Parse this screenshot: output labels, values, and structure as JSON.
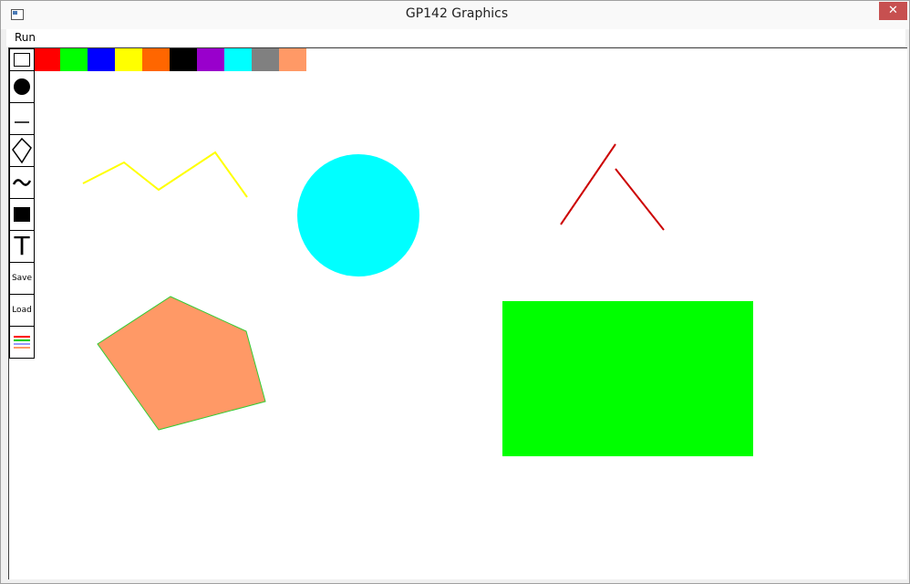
{
  "window": {
    "title": "GP142 Graphics",
    "close_label": "✕"
  },
  "menu": {
    "items": [
      "Run"
    ]
  },
  "toolbox": {
    "tools": [
      {
        "name": "rectangle-outline-tool",
        "icon": "rect-outline-icon"
      },
      {
        "name": "filled-circle-tool",
        "icon": "filled-circle-icon"
      },
      {
        "name": "line-tool",
        "icon": "line-icon"
      },
      {
        "name": "polygon-tool",
        "icon": "diamond-outline-icon"
      },
      {
        "name": "freehand-tool",
        "icon": "tilde-icon"
      },
      {
        "name": "filled-rectangle-tool",
        "icon": "filled-square-icon"
      },
      {
        "name": "text-tool",
        "icon": "text-t-icon",
        "label": "T"
      },
      {
        "name": "save-tool",
        "label": "Save"
      },
      {
        "name": "load-tool",
        "label": "Load"
      },
      {
        "name": "line-width-tool",
        "icon": "colored-lines-icon"
      }
    ]
  },
  "palette": {
    "colors": [
      "#ff0000",
      "#00ff00",
      "#0000ff",
      "#ffff00",
      "#ff6600",
      "#000000",
      "#9900cc",
      "#00ffff",
      "#808080",
      "#ff9966"
    ]
  },
  "shapes": {
    "yellow_polyline_color": "#ffff00",
    "cyan_circle_color": "#00ffff",
    "red_lines_color": "#cc0000",
    "pentagon_fill": "#ff9966",
    "pentagon_stroke": "#33cc33",
    "green_rect_color": "#00ff00"
  }
}
